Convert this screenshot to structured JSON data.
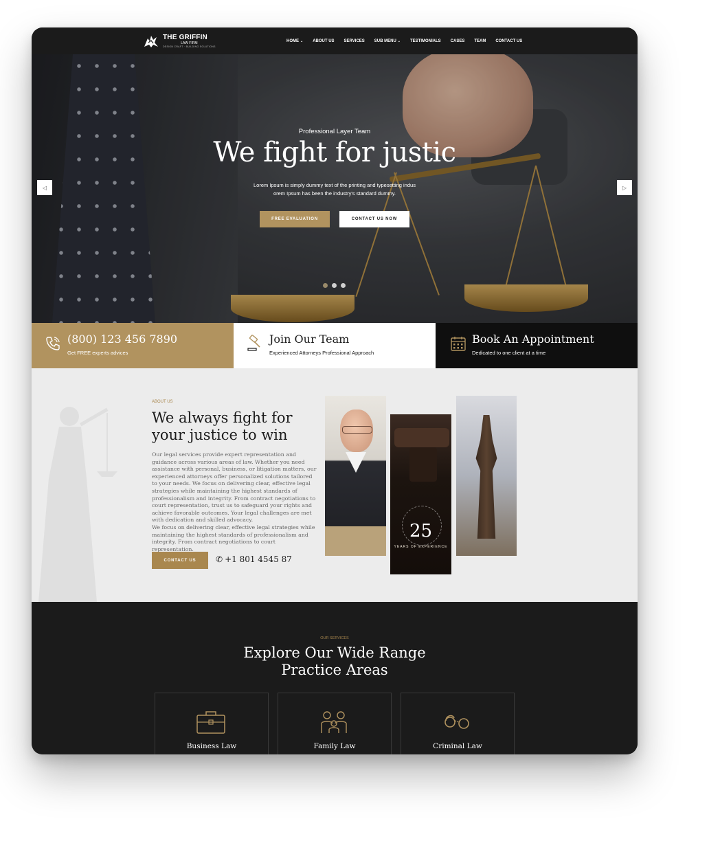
{
  "brand": {
    "title": "THE GRIFFIN",
    "subtitle": "LAW FIRM",
    "tagline": "DESIGN CRAFT · BUILDING SOLUTIONS"
  },
  "nav": {
    "items": [
      {
        "label": "HOME",
        "dropdown": true
      },
      {
        "label": "ABOUT US",
        "dropdown": false
      },
      {
        "label": "SERVICES",
        "dropdown": false
      },
      {
        "label": "SUB MENU",
        "dropdown": true
      },
      {
        "label": "TESTIMONIALS",
        "dropdown": false
      },
      {
        "label": "CASES",
        "dropdown": false
      },
      {
        "label": "TEAM",
        "dropdown": false
      },
      {
        "label": "CONTACT US",
        "dropdown": false
      }
    ]
  },
  "hero": {
    "eyebrow": "Professional Layer Team",
    "title": "We fight for justic",
    "desc_line1": "Lorem Ipsum is simply dummy text of the printing and typesetting indus",
    "desc_line2": "orem Ipsum has been the industry's standard dummy.",
    "btn_primary": "FREE EVALUATION",
    "btn_secondary": "CONTACT US NOW",
    "slide_count": 3,
    "active_slide": 1
  },
  "strip": {
    "phone_title": "(800) 123 456 7890",
    "phone_sub": "Get FREE experts advices",
    "team_title": "Join Our Team",
    "team_sub": "Experienced Attorneys Professional Approach",
    "appt_title": "Book An Appointment",
    "appt_sub": "Dedicated to one client at a time"
  },
  "about": {
    "eyebrow": "ABOUT US",
    "title_line1": "We always fight for",
    "title_line2": "your justice to win",
    "para1": "Our legal services provide expert representation and guidance across various areas of law. Whether you need assistance with personal, business, or litigation matters, our experienced attorneys offer personalized solutions tailored to your needs. We focus on delivering clear, effective legal strategies while maintaining the highest standards of professionalism and integrity. From contract negotiations to court representation, trust us to safeguard your rights and achieve favorable outcomes. Your legal challenges are met with dedication and skilled advocacy.",
    "para2": "We focus on delivering clear, effective legal strategies while maintaining the highest standards of professionalism and integrity. From contract negotiations to court representation.",
    "button": "CONTACT US",
    "phone": "+1 801 4545 87",
    "years_number": "25",
    "years_text": "YEARS OF EXPERIENCE"
  },
  "services": {
    "eyebrow": "OUR SERVICES",
    "title_line1": "Explore Our Wide Range",
    "title_line2": "Practice Areas",
    "cards": [
      {
        "label": "Business Law",
        "icon": "briefcase-icon"
      },
      {
        "label": "Family Law",
        "icon": "family-icon"
      },
      {
        "label": "Criminal Law",
        "icon": "handcuffs-icon"
      }
    ]
  },
  "colors": {
    "gold": "#b1935f",
    "dark": "#1b1b1b",
    "black": "#0f0f0f",
    "light": "#ececec"
  }
}
